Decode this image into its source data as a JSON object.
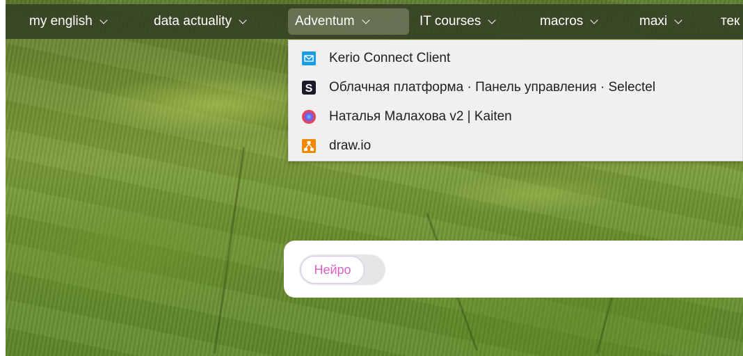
{
  "bookmarks_bar": {
    "items": [
      {
        "label": "my english"
      },
      {
        "label": "data actuality"
      },
      {
        "label": "Adventum"
      },
      {
        "label": "IT courses"
      },
      {
        "label": "macros"
      },
      {
        "label": "maxi"
      },
      {
        "label": "тек"
      }
    ]
  },
  "dropdown": {
    "items": [
      {
        "label": "Kerio Connect Client",
        "icon": "mail-icon"
      },
      {
        "label": "Облачная платформа · Панель управления · Selectel",
        "icon": "selectel-icon"
      },
      {
        "label": "Наталья Малахова v2 | Kaiten",
        "icon": "kaiten-icon"
      },
      {
        "label": "draw.io",
        "icon": "drawio-icon"
      }
    ]
  },
  "search": {
    "toggle_label": "Нейро"
  },
  "colors": {
    "bar_bg": "#344026",
    "dropdown_bg": "#f0f0f0",
    "neuro_text": "#d862c8"
  }
}
